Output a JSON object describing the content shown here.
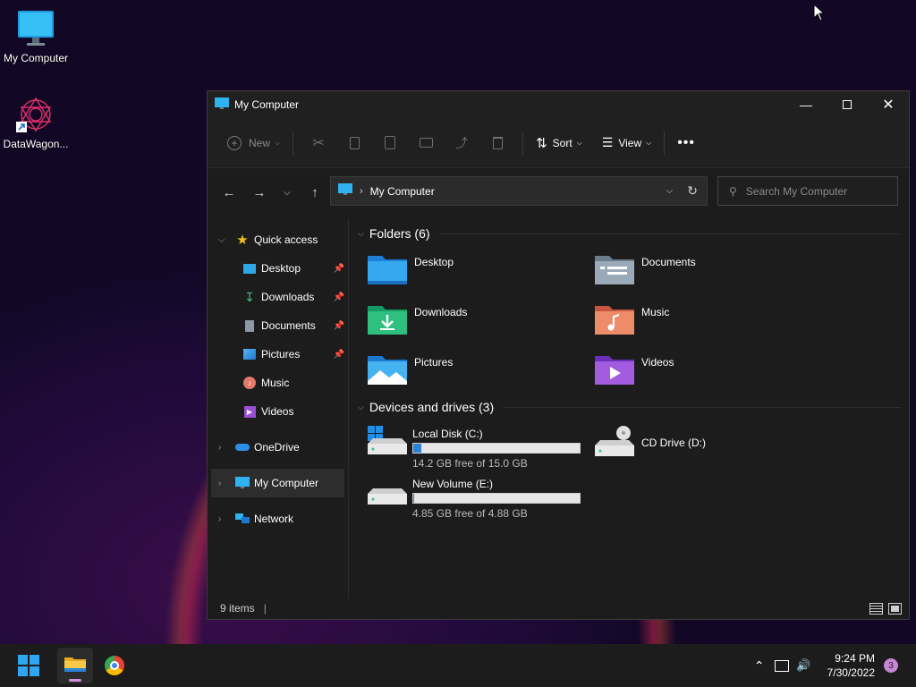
{
  "desktop": {
    "icons": [
      {
        "label": "My Computer"
      },
      {
        "label": "DataWagon..."
      }
    ]
  },
  "window": {
    "title": "My Computer",
    "toolbar": {
      "new_label": "New",
      "sort_label": "Sort",
      "view_label": "View"
    },
    "address": {
      "path": "My Computer"
    },
    "search": {
      "placeholder": "Search My Computer"
    },
    "sidebar": {
      "quick_access": "Quick access",
      "items": [
        {
          "label": "Desktop"
        },
        {
          "label": "Downloads"
        },
        {
          "label": "Documents"
        },
        {
          "label": "Pictures"
        },
        {
          "label": "Music"
        },
        {
          "label": "Videos"
        }
      ],
      "onedrive": "OneDrive",
      "my_computer": "My Computer",
      "network": "Network"
    },
    "folders_header": "Folders (6)",
    "folders": [
      {
        "name": "Desktop"
      },
      {
        "name": "Documents"
      },
      {
        "name": "Downloads"
      },
      {
        "name": "Music"
      },
      {
        "name": "Pictures"
      },
      {
        "name": "Videos"
      }
    ],
    "drives_header": "Devices and drives (3)",
    "drives": [
      {
        "name": "Local Disk (C:)",
        "free": "14.2 GB free of 15.0 GB",
        "used_fraction": 0.05
      },
      {
        "name": "CD Drive (D:)"
      },
      {
        "name": "New Volume (E:)",
        "free": "4.85 GB free of 4.88 GB",
        "used_fraction": 0.006
      }
    ],
    "status": {
      "items": "9 items"
    }
  },
  "taskbar": {
    "time": "9:24 PM",
    "date": "7/30/2022",
    "notifications": "3"
  }
}
